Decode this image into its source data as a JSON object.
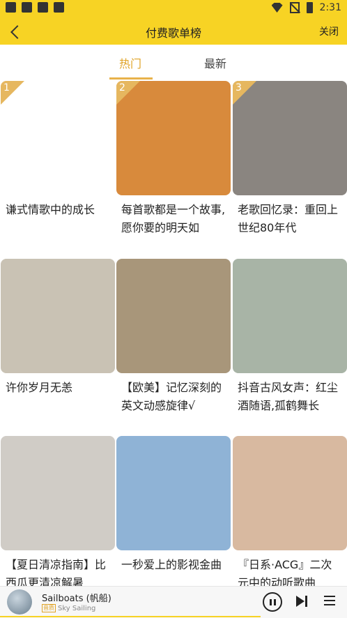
{
  "status_bar": {
    "time": "2:31"
  },
  "header": {
    "title": "付费歌单榜",
    "close_label": "关闭"
  },
  "tabs": [
    {
      "label": "热门",
      "active": true
    },
    {
      "label": "最新",
      "active": false
    }
  ],
  "playlists": [
    {
      "rank": "1",
      "title": "谦式情歌中的成长",
      "cover": "hooded-figure-illustration",
      "bg": "#ffffff"
    },
    {
      "rank": "2",
      "title": "每首歌都是一个故事,愿你要的明天如",
      "cover": "sunset-sailboat-sea",
      "bg": "#d88a3c"
    },
    {
      "rank": "3",
      "title": "老歌回忆录：重回上世纪80年代",
      "cover": "vintage-woman-portrait",
      "bg": "#8a8580"
    },
    {
      "rank": "",
      "title": "许你岁月无恙",
      "cover": "students-uniform",
      "bg": "#c9c2b4"
    },
    {
      "rank": "",
      "title": "【欧美】记忆深刻的英文动感旋律√",
      "cover": "girl-with-guitar-field",
      "bg": "#a8967a"
    },
    {
      "rank": "",
      "title": "抖音古风女声：红尘酒随语,孤鹤舞长",
      "cover": "ancient-style-painting",
      "bg": "#a8b4a6"
    },
    {
      "rank": "",
      "title": "【夏日清凉指南】比西瓜更清凉解暑",
      "cover": "tattooed-hands-sketch",
      "bg": "#d0ccc6"
    },
    {
      "rank": "",
      "title": "一秒爱上的影视金曲",
      "cover": "anime-street-scene",
      "bg": "#8fb3d6"
    },
    {
      "rank": "",
      "title": "『日系·ACG』二次元中的动听歌曲",
      "cover": "anime-couple-holding-hands",
      "bg": "#d8b9a0"
    }
  ],
  "player": {
    "title": "Sailboats (帆船)",
    "tag": "音质",
    "artist": "Sky Sailing",
    "progress": 0.75
  }
}
